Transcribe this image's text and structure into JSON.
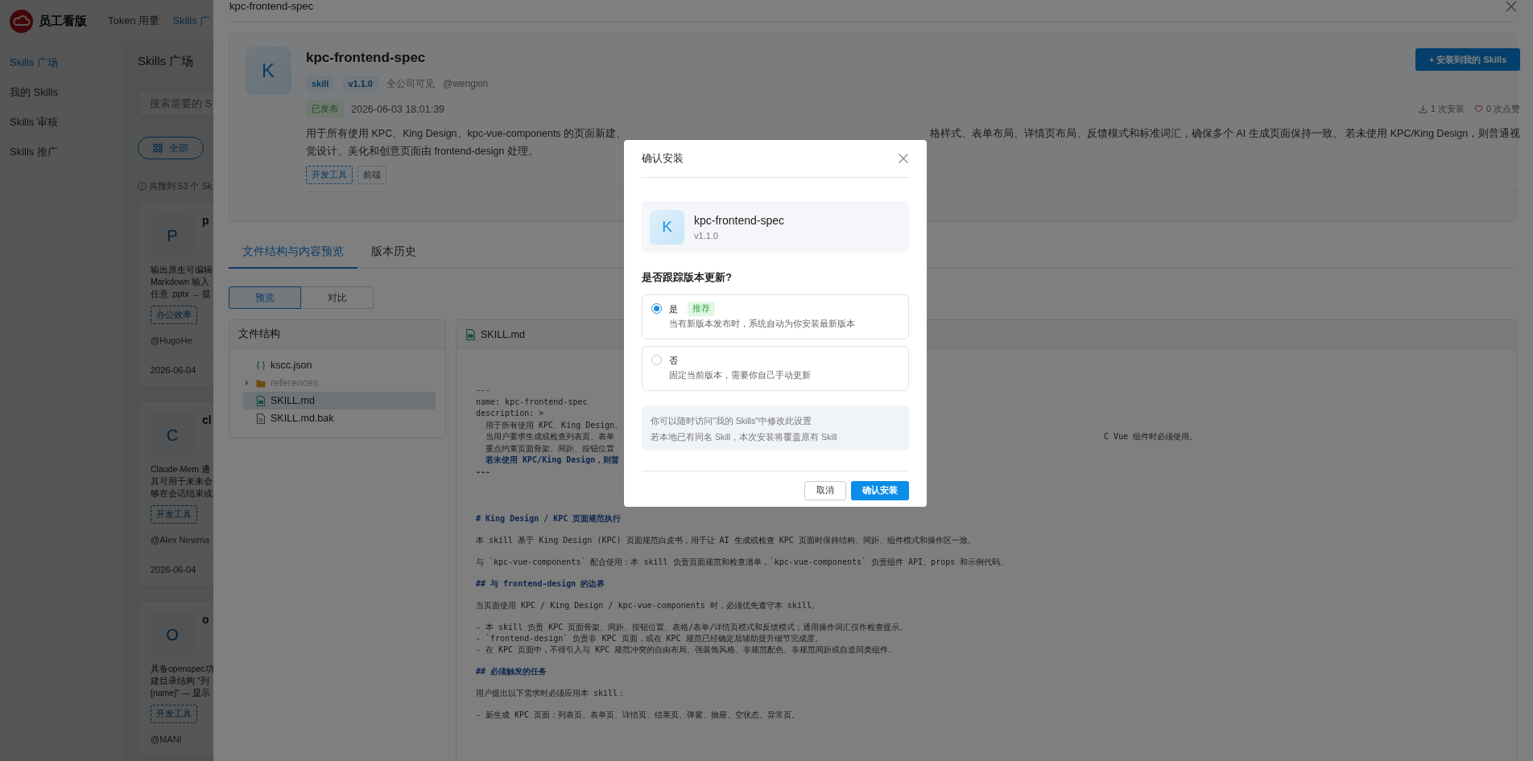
{
  "background_page": {
    "brand": "员工看版",
    "top_nav": [
      {
        "label": "Token 用量",
        "selected": false
      },
      {
        "label": "Skills 广",
        "selected": true
      }
    ],
    "sidebar": {
      "items": [
        {
          "label": "Skills 广场",
          "selected": true
        },
        {
          "label": "我的 Skills",
          "selected": false
        },
        {
          "label": "Skills 审核",
          "selected": false
        },
        {
          "label": "Skills 推广",
          "selected": false
        }
      ]
    },
    "title": "Skills 广场",
    "search": {
      "placeholder": "搜索需要的 S"
    },
    "filter_chip": {
      "label": "全部"
    },
    "result_count": "共搜到 53 个 Sk",
    "cards": [
      {
        "avatar": "P",
        "title": "p",
        "lines": [
          "输出原生可编辑",
          "Markdown 输入",
          "任意 .pptx → 提"
        ],
        "tags": [
          "办公效率"
        ],
        "author": "@HugoHe",
        "date": "2026-06-04"
      },
      {
        "avatar": "C",
        "title": "cl",
        "lines": [
          "Claude-Mem 通",
          "其可用于未来会",
          "够在会话结束或"
        ],
        "tags": [
          "开发工具"
        ],
        "author": "@Alex Newma",
        "date": "2026-06-04"
      },
      {
        "avatar": "O",
        "title": "o",
        "lines": [
          "具备openspec功",
          "建目录结构 \"列",
          "[name]\" — 显示"
        ],
        "tags": [
          "开发工具"
        ],
        "author": "@MANI"
      }
    ]
  },
  "drawer": {
    "title": "kpc-frontend-spec",
    "skill": {
      "avatar": "K",
      "name": "kpc-frontend-spec",
      "tags": [
        {
          "label": "skill",
          "kind": "type"
        },
        {
          "label": "v1.1.0",
          "kind": "version"
        }
      ],
      "visibility": "全公司可见",
      "owner": "@wengxin",
      "status": "已发布",
      "updated": "2026-06-03 18:01:39",
      "install_button": "+ 安装到我的 Skills",
      "installs": "1 次安装",
      "likes": "0 次点赞",
      "description_left": [
        "用于所有使用 KPC、King Design、kpc-vue-components 的页面新建、",
        "觉设计、美化和创意页面由 frontend-design 处理。"
      ],
      "description_right": [
        "格样式、表单布局、详情页布局、反馈模式和标准词汇，确保多个 AI 生成页面保持一致。 若未使用 KPC/King Design，则普通视"
      ],
      "categories": [
        {
          "label": "开发工具",
          "kind": "primary"
        },
        {
          "label": "前端",
          "kind": "secondary"
        }
      ]
    },
    "tabs": [
      {
        "label": "文件结构与内容预览",
        "selected": true
      },
      {
        "label": "版本历史",
        "selected": false
      }
    ],
    "view_toggle": [
      {
        "label": "预览",
        "selected": true
      },
      {
        "label": "对比",
        "selected": false
      }
    ],
    "file_tree": {
      "title": "文件结构",
      "items": [
        {
          "name": "kscc.json",
          "kind": "json",
          "selected": false
        },
        {
          "name": "references",
          "kind": "folder",
          "selected": false,
          "expanded": false
        },
        {
          "name": "SKILL.md",
          "kind": "markdown",
          "selected": true
        },
        {
          "name": "SKILL.md.bak",
          "kind": "file",
          "selected": false
        }
      ]
    },
    "preview": {
      "file_name": "SKILL.md",
      "front_matter": [
        {
          "left": "---",
          "kind": "plain"
        },
        {
          "left": "name: kpc-frontend-spec",
          "kind": "plain"
        },
        {
          "left": "description: >",
          "kind": "plain"
        },
        {
          "left": "  用于所有使用 KPC、King Design、",
          "kind": "plain"
        },
        {
          "left": "  当用户要求生成或检查列表页、表单",
          "right": "C Vue 组件时必须使用。",
          "kind": "plain"
        },
        {
          "left": "  重点约束页面骨架、间距、按钮位置",
          "kind": "plain"
        },
        {
          "left": "  若未使用 KPC/King Design，则普",
          "kind": "emphasis"
        },
        {
          "left": "---",
          "kind": "emphasis"
        }
      ],
      "blocks": [
        {
          "kind": "heading",
          "lines": [
            "# King Design / KPC 页面规范执行"
          ]
        },
        {
          "kind": "paragraph",
          "lines": [
            "本 skill 基于 King Design (KPC) 页面规范白皮书，用于让 AI 生成或检查 KPC 页面时保持结构、间距、组件模式和操作区一致。"
          ]
        },
        {
          "kind": "paragraph",
          "lines": [
            "与 `kpc-vue-components` 配合使用：本 skill 负责页面规范和检查清单，`kpc-vue-components` 负责组件 API、props 和示例代码。"
          ]
        },
        {
          "kind": "heading",
          "lines": [
            "## 与 frontend-design 的边界"
          ]
        },
        {
          "kind": "paragraph",
          "lines": [
            "当页面使用 KPC / King Design / kpc-vue-components 时，必须优先遵守本 skill。"
          ]
        },
        {
          "kind": "paragraph",
          "lines": [
            "- 本 skill 负责 KPC 页面骨架、间距、按钮位置、表格/表单/详情页模式和反馈模式；通用操作词汇仅作检查提示。",
            "- `frontend-design` 负责非 KPC 页面，或在 KPC 规范已经确定后辅助提升细节完成度。",
            "- 在 KPC 页面中，不得引入与 KPC 规范冲突的自由布局、强装饰风格、非规范配色、非规范间距或自造同类组件。"
          ]
        },
        {
          "kind": "heading",
          "lines": [
            "## 必须触发的任务"
          ]
        },
        {
          "kind": "paragraph",
          "lines": [
            "用户提出以下需求时必须应用本 skill："
          ]
        },
        {
          "kind": "paragraph",
          "lines": [
            "- 新生成 KPC 页面：列表页、表单页、详情页、结果页、弹窗、抽屉、空状态、异常页。"
          ]
        }
      ]
    }
  },
  "modal": {
    "title": "确认安装",
    "skill": {
      "avatar": "K",
      "name": "kpc-frontend-spec",
      "version": "v1.1.0"
    },
    "question": "是否跟踪版本更新?",
    "options": [
      {
        "label": "是",
        "badge": "推荐",
        "description": "当有新版本发布时，系统自动为你安装最新版本",
        "selected": true
      },
      {
        "label": "否",
        "description": "固定当前版本，需要你自己手动更新",
        "selected": false
      }
    ],
    "notes": [
      "你可以随时访问\"我的 Skills\"中修改此设置",
      "若本地已有同名 Skill，本次安装将覆盖原有 Skill"
    ],
    "buttons": [
      {
        "label": "取消",
        "kind": "default"
      },
      {
        "label": "确认安装",
        "kind": "primary"
      }
    ]
  }
}
